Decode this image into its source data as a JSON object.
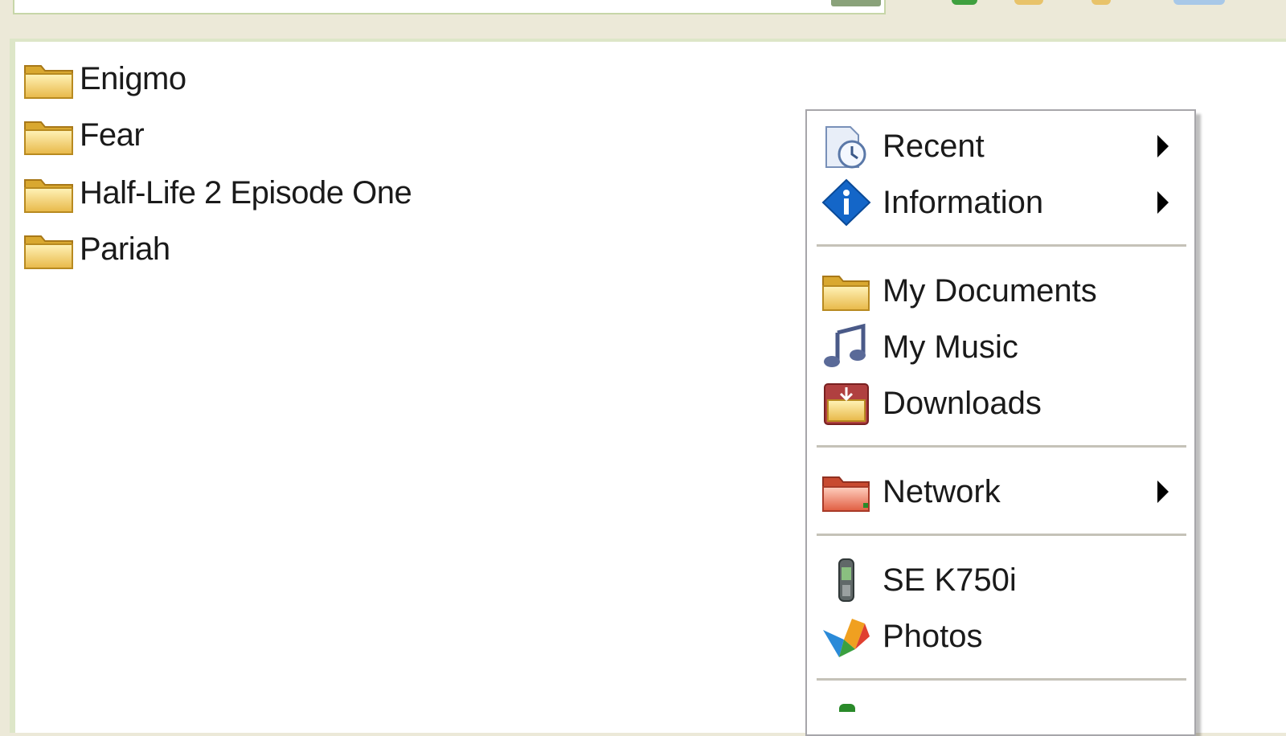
{
  "files": [
    {
      "name": "Enigmo",
      "icon": "folder-icon"
    },
    {
      "name": "Fear",
      "icon": "folder-icon"
    },
    {
      "name": "Half-Life 2 Episode One",
      "icon": "folder-icon"
    },
    {
      "name": "Pariah",
      "icon": "folder-icon"
    }
  ],
  "menu": {
    "items": [
      {
        "label": "Recent",
        "icon": "recent-documents-icon",
        "submenu": true
      },
      {
        "label": "Information",
        "icon": "information-icon",
        "submenu": true
      },
      {
        "label": "My Documents",
        "icon": "folder-icon",
        "submenu": false
      },
      {
        "label": "My Music",
        "icon": "music-icon",
        "submenu": false
      },
      {
        "label": "Downloads",
        "icon": "downloads-icon",
        "submenu": false
      },
      {
        "label": "Network",
        "icon": "network-folder-icon",
        "submenu": true
      },
      {
        "label": "SE K750i",
        "icon": "mobile-phone-icon",
        "submenu": false
      },
      {
        "label": "Photos",
        "icon": "photos-icon",
        "submenu": false
      }
    ]
  },
  "colors": {
    "window_background": "#ece9d8",
    "pane_border": "#dde6c8",
    "folder_yellow": "#f0d070",
    "info_blue": "#1466c8",
    "network_red": "#e06a50"
  }
}
